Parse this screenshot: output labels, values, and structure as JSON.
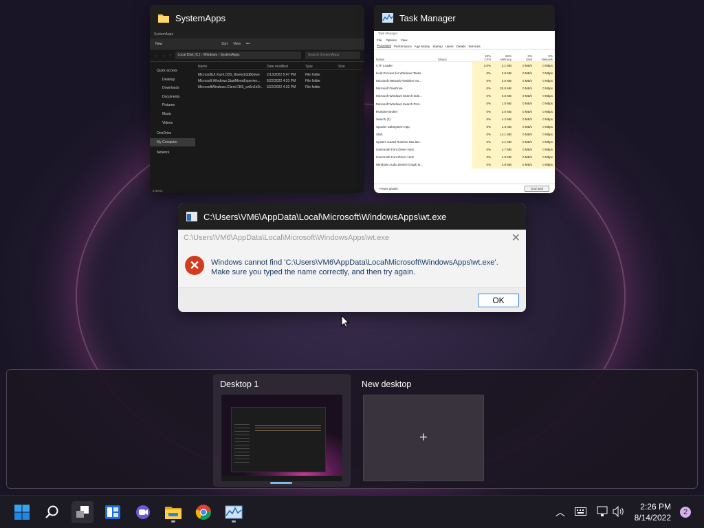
{
  "windows": {
    "explorer": {
      "title": "SystemApps",
      "inner_title": "SystemApps",
      "toolbar": [
        "New",
        "Sort",
        "View",
        "•••"
      ],
      "breadcrumb": "Local Disk (C:) › Windows › SystemApps",
      "search_placeholder": "Search SystemApps",
      "nav_items": [
        "Quick access",
        "Desktop",
        "Downloads",
        "Documents",
        "Pictures",
        "Music",
        "Videos",
        "OneDrive",
        "My Computer",
        "Network"
      ],
      "columns": [
        "Name",
        "Date modified",
        "Type",
        "Size"
      ],
      "files": [
        {
          "name": "MicrosoftUI.Xaml.CBS_8wekyb3d8bbwe",
          "date": "2/13/2022 5:47 PM",
          "type": "File folder"
        },
        {
          "name": "Microsoft.Windows.StartMenuExperien...",
          "date": "6/22/2022 4:31 PM",
          "type": "File folder"
        },
        {
          "name": "MicrosoftWindows.Client.CBS_cw5n1h2t...",
          "date": "6/22/2022 4:32 PM",
          "type": "File folder"
        }
      ],
      "status": "3 items"
    },
    "task_manager": {
      "title": "Task Manager",
      "inner_title": "Task Manager",
      "menu": [
        "File",
        "Options",
        "View"
      ],
      "tabs": [
        "Processes",
        "Performance",
        "App history",
        "Startup",
        "Users",
        "Details",
        "Services"
      ],
      "columns": {
        "name": "Name",
        "status": "Status",
        "cpu_pct": "18%",
        "cpu": "CPU",
        "mem_pct": "26%",
        "mem": "Memory",
        "disk_pct": "0%",
        "disk": "Disk",
        "net_pct": "0%",
        "net": "Network"
      },
      "processes": [
        {
          "name": "CTF Loader",
          "cpu": "2.0%",
          "mem": "2.1 MB",
          "disk": "0 MB/s",
          "net": "0 Mbps"
        },
        {
          "name": "Host Process for Windows Tasks",
          "cpu": "0%",
          "mem": "2.8 MB",
          "disk": "0 MB/s",
          "net": "0 Mbps"
        },
        {
          "name": "Microsoft Network Realtime Ins...",
          "cpu": "0%",
          "mem": "2.5 MB",
          "disk": "0 MB/s",
          "net": "0 Mbps"
        },
        {
          "name": "Microsoft OneDrive",
          "cpu": "0%",
          "mem": "20.8 MB",
          "disk": "0 MB/s",
          "net": "0 Mbps"
        },
        {
          "name": "Microsoft Windows Search Inde...",
          "cpu": "0%",
          "mem": "6.6 MB",
          "disk": "0 MB/s",
          "net": "0 Mbps"
        },
        {
          "name": "Microsoft Windows Search Prot...",
          "cpu": "0%",
          "mem": "1.5 MB",
          "disk": "0 MB/s",
          "net": "0 Mbps"
        },
        {
          "name": "Runtime Broker",
          "cpu": "0%",
          "mem": "2.0 MB",
          "disk": "0 MB/s",
          "net": "0 Mbps"
        },
        {
          "name": "Search (3)",
          "cpu": "0%",
          "mem": "4.2 MB",
          "disk": "0 MB/s",
          "net": "0 Mbps"
        },
        {
          "name": "Spooler SubSystem App",
          "cpu": "0%",
          "mem": "1.3 MB",
          "disk": "0 MB/s",
          "net": "0 Mbps"
        },
        {
          "name": "Start",
          "cpu": "0%",
          "mem": "14.1 MB",
          "disk": "0 MB/s",
          "net": "0 Mbps"
        },
        {
          "name": "System Guard Runtime Monitor...",
          "cpu": "0%",
          "mem": "4.1 MB",
          "disk": "0 MB/s",
          "net": "0 Mbps"
        },
        {
          "name": "Usermode Font Driver Host",
          "cpu": "0%",
          "mem": "2.7 MB",
          "disk": "0 MB/s",
          "net": "0 Mbps"
        },
        {
          "name": "Usermode Font Driver Host",
          "cpu": "0%",
          "mem": "1.8 MB",
          "disk": "0 MB/s",
          "net": "0 Mbps"
        },
        {
          "name": "Windows Audio Device Graph Is...",
          "cpu": "0%",
          "mem": "3.8 MB",
          "disk": "0 MB/s",
          "net": "0 Mbps"
        }
      ],
      "fewer_details": "Fewer details",
      "end_task": "End task"
    },
    "error_dialog": {
      "title": "C:\\Users\\VM6\\AppData\\Local\\Microsoft\\WindowsApps\\wt.exe",
      "inner_title": "C:\\Users\\VM6\\AppData\\Local\\Microsoft\\WindowsApps\\wt.exe",
      "message": "Windows cannot find 'C:\\Users\\VM6\\AppData\\Local\\Microsoft\\WindowsApps\\wt.exe'. Make sure you typed the name correctly, and then try again.",
      "ok_label": "OK",
      "close_glyph": "✕",
      "error_glyph": "✕"
    }
  },
  "desktops": {
    "items": [
      {
        "label": "Desktop 1",
        "active": true
      },
      {
        "label": "New desktop",
        "active": false
      }
    ],
    "plus_glyph": "+"
  },
  "taskbar": {
    "icons": [
      "windows-start-icon",
      "search-icon",
      "task-view-icon",
      "widgets-icon",
      "teams-chat-icon",
      "file-explorer-icon",
      "chrome-icon",
      "task-manager-icon"
    ],
    "time": "2:26 PM",
    "date": "8/14/2022",
    "notification_count": "2",
    "tray_chevron": "^",
    "colors": {
      "accent": "#0078d4",
      "error": "#d33b1f",
      "badge": "#d8b2f0"
    }
  }
}
